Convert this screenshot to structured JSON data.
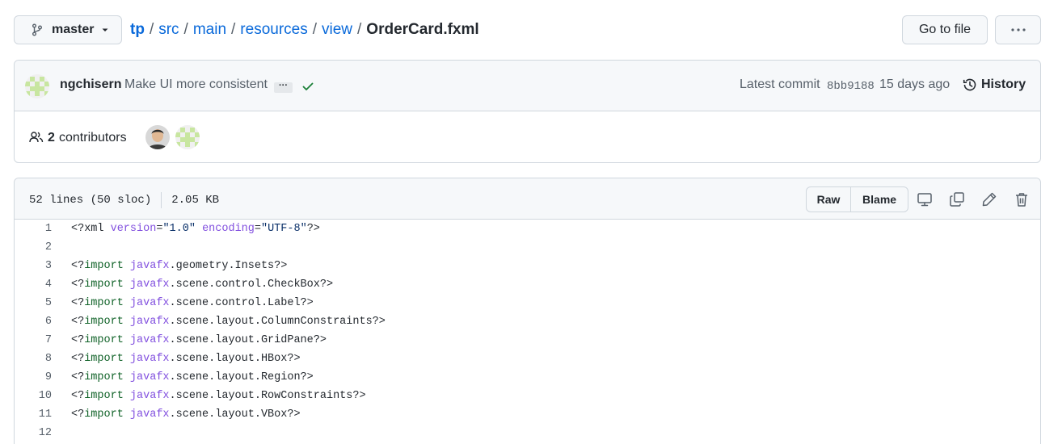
{
  "branch": {
    "name": "master"
  },
  "breadcrumb": {
    "segments": [
      "tp",
      "src",
      "main",
      "resources",
      "view"
    ],
    "separator": "/",
    "file": "OrderCard.fxml"
  },
  "toolbar": {
    "goto_label": "Go to file",
    "more_label": "···"
  },
  "commit": {
    "author": "ngchisern",
    "message": "Make UI more consistent",
    "expand_label": "···",
    "latest_label": "Latest commit",
    "sha": "8bb9188",
    "ago": "15 days ago",
    "history_label": "History"
  },
  "contributors": {
    "count": "2",
    "label": "contributors"
  },
  "file": {
    "lines_info": "52 lines (50 sloc)",
    "size": "2.05 KB",
    "raw_label": "Raw",
    "blame_label": "Blame"
  },
  "colors": {
    "link": "#0969da",
    "keyword": "#116329",
    "attribute": "#8250df",
    "string": "#0a3069",
    "success": "#1a7f37"
  },
  "code": [
    {
      "n": "1",
      "t": [
        [
          "",
          "<?xml "
        ],
        [
          "at",
          "version"
        ],
        [
          "",
          "="
        ],
        [
          "st",
          "\"1.0\""
        ],
        [
          "",
          " "
        ],
        [
          "at",
          "encoding"
        ],
        [
          "",
          "="
        ],
        [
          "st",
          "\"UTF-8\""
        ],
        [
          "",
          "?>"
        ]
      ]
    },
    {
      "n": "2",
      "t": []
    },
    {
      "n": "3",
      "t": [
        [
          "",
          "<?"
        ],
        [
          "kw",
          "import"
        ],
        [
          "",
          " "
        ],
        [
          "at",
          "javafx"
        ],
        [
          "",
          ".geometry.Insets?>"
        ]
      ]
    },
    {
      "n": "4",
      "t": [
        [
          "",
          "<?"
        ],
        [
          "kw",
          "import"
        ],
        [
          "",
          " "
        ],
        [
          "at",
          "javafx"
        ],
        [
          "",
          ".scene.control.CheckBox?>"
        ]
      ]
    },
    {
      "n": "5",
      "t": [
        [
          "",
          "<?"
        ],
        [
          "kw",
          "import"
        ],
        [
          "",
          " "
        ],
        [
          "at",
          "javafx"
        ],
        [
          "",
          ".scene.control.Label?>"
        ]
      ]
    },
    {
      "n": "6",
      "t": [
        [
          "",
          "<?"
        ],
        [
          "kw",
          "import"
        ],
        [
          "",
          " "
        ],
        [
          "at",
          "javafx"
        ],
        [
          "",
          ".scene.layout.ColumnConstraints?>"
        ]
      ]
    },
    {
      "n": "7",
      "t": [
        [
          "",
          "<?"
        ],
        [
          "kw",
          "import"
        ],
        [
          "",
          " "
        ],
        [
          "at",
          "javafx"
        ],
        [
          "",
          ".scene.layout.GridPane?>"
        ]
      ]
    },
    {
      "n": "8",
      "t": [
        [
          "",
          "<?"
        ],
        [
          "kw",
          "import"
        ],
        [
          "",
          " "
        ],
        [
          "at",
          "javafx"
        ],
        [
          "",
          ".scene.layout.HBox?>"
        ]
      ]
    },
    {
      "n": "9",
      "t": [
        [
          "",
          "<?"
        ],
        [
          "kw",
          "import"
        ],
        [
          "",
          " "
        ],
        [
          "at",
          "javafx"
        ],
        [
          "",
          ".scene.layout.Region?>"
        ]
      ]
    },
    {
      "n": "10",
      "t": [
        [
          "",
          "<?"
        ],
        [
          "kw",
          "import"
        ],
        [
          "",
          " "
        ],
        [
          "at",
          "javafx"
        ],
        [
          "",
          ".scene.layout.RowConstraints?>"
        ]
      ]
    },
    {
      "n": "11",
      "t": [
        [
          "",
          "<?"
        ],
        [
          "kw",
          "import"
        ],
        [
          "",
          " "
        ],
        [
          "at",
          "javafx"
        ],
        [
          "",
          ".scene.layout.VBox?>"
        ]
      ]
    },
    {
      "n": "12",
      "t": []
    }
  ]
}
